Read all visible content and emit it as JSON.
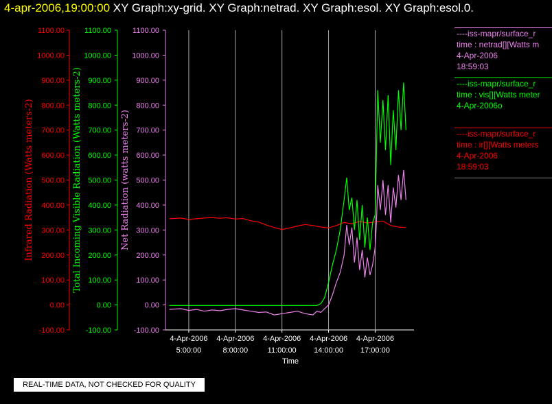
{
  "header": {
    "timestamp": "4-apr-2006,19:00:00",
    "graphs": [
      "XY Graph:xy-grid.",
      "XY Graph:netrad.",
      "XY Graph:esol.",
      "XY Graph:esol.0."
    ]
  },
  "legend": [
    {
      "line1": "----iss-mapr/surface_r",
      "line2": "time : netrad[][Watts m",
      "line3": "4-Apr-2006",
      "line4": "18:59:03",
      "color": "#ee82ee"
    },
    {
      "line1": "----iss-mapr/surface_r",
      "line2": "time : vis[][Watts meter",
      "line3": "4-Apr-2006o",
      "line4": "",
      "color": "#00ff00"
    },
    {
      "line1": "----iss-mapr/surface_r",
      "line2": "time : ir[][Watts meters",
      "line3": "4-Apr-2006",
      "line4": "18:59:03",
      "color": "#ff0000"
    }
  ],
  "notice": "REAL-TIME DATA, NOT CHECKED FOR QUALITY",
  "chart_data": {
    "type": "line",
    "xlabel": "Time",
    "x_range": [
      "4-Apr-2006 03:30:00",
      "4-Apr-2006 19:30:00"
    ],
    "x_ticks": [
      {
        "date": "4-Apr-2006",
        "time": "5:00:00",
        "x": "4-Apr-2006 05:00:00"
      },
      {
        "date": "4-Apr-2006",
        "time": "8:00:00",
        "x": "4-Apr-2006 08:00:00"
      },
      {
        "date": "4-Apr-2006",
        "time": "11:00:00",
        "x": "4-Apr-2006 11:00:00"
      },
      {
        "date": "4-Apr-2006",
        "time": "14:00:00",
        "x": "4-Apr-2006 14:00:00"
      },
      {
        "date": "4-Apr-2006",
        "time": "17:00:00",
        "x": "4-Apr-2006 17:00:00"
      }
    ],
    "y_ticks": [
      "1100.00",
      "1000.00",
      "900.00",
      "800.00",
      "700.00",
      "600.00",
      "500.00",
      "400.00",
      "300.00",
      "200.00",
      "100.00",
      "0.00",
      "-100.00"
    ],
    "ylim": [
      -100,
      1100
    ],
    "grid": "vertical lines at time ticks",
    "axes": [
      {
        "label": "Infrared Radiation (Watts meters-2)",
        "color": "#ff0000"
      },
      {
        "label": "Total Incoming Visible Radiation (Watts meters-2)",
        "color": "#00ff00"
      },
      {
        "label": "Net Radiation (watts meters-2)",
        "color": "#ee82ee"
      }
    ],
    "series": [
      {
        "color": "#ff0000",
        "points": [
          [
            "4-Apr-2006 03:45:00",
            345
          ],
          [
            "4-Apr-2006 04:30:00",
            348
          ],
          [
            "4-Apr-2006 05:00:00",
            342
          ],
          [
            "4-Apr-2006 05:30:00",
            345
          ],
          [
            "4-Apr-2006 06:00:00",
            348
          ],
          [
            "4-Apr-2006 06:30:00",
            350
          ],
          [
            "4-Apr-2006 07:00:00",
            347
          ],
          [
            "4-Apr-2006 07:30:00",
            349
          ],
          [
            "4-Apr-2006 08:00:00",
            344
          ],
          [
            "4-Apr-2006 08:30:00",
            346
          ],
          [
            "4-Apr-2006 09:00:00",
            337
          ],
          [
            "4-Apr-2006 09:30:00",
            332
          ],
          [
            "4-Apr-2006 10:00:00",
            320
          ],
          [
            "4-Apr-2006 10:30:00",
            310
          ],
          [
            "4-Apr-2006 11:00:00",
            302
          ],
          [
            "4-Apr-2006 11:30:00",
            308
          ],
          [
            "4-Apr-2006 12:00:00",
            316
          ],
          [
            "4-Apr-2006 12:30:00",
            322
          ],
          [
            "4-Apr-2006 13:00:00",
            318
          ],
          [
            "4-Apr-2006 13:30:00",
            312
          ],
          [
            "4-Apr-2006 14:00:00",
            308
          ],
          [
            "4-Apr-2006 14:30:00",
            318
          ],
          [
            "4-Apr-2006 15:00:00",
            330
          ],
          [
            "4-Apr-2006 15:30:00",
            325
          ],
          [
            "4-Apr-2006 16:00:00",
            335
          ],
          [
            "4-Apr-2006 16:30:00",
            328
          ],
          [
            "4-Apr-2006 17:00:00",
            332
          ],
          [
            "4-Apr-2006 17:30:00",
            336
          ],
          [
            "4-Apr-2006 18:00:00",
            318
          ],
          [
            "4-Apr-2006 18:30:00",
            312
          ],
          [
            "4-Apr-2006 18:59:00",
            310
          ]
        ]
      },
      {
        "color": "#00ff00",
        "points": [
          [
            "4-Apr-2006 03:45:00",
            -2
          ],
          [
            "4-Apr-2006 06:00:00",
            -2
          ],
          [
            "4-Apr-2006 08:00:00",
            -2
          ],
          [
            "4-Apr-2006 10:00:00",
            -2
          ],
          [
            "4-Apr-2006 12:00:00",
            -2
          ],
          [
            "4-Apr-2006 13:15:00",
            -2
          ],
          [
            "4-Apr-2006 13:30:00",
            5
          ],
          [
            "4-Apr-2006 13:45:00",
            30
          ],
          [
            "4-Apr-2006 14:00:00",
            90
          ],
          [
            "4-Apr-2006 14:15:00",
            160
          ],
          [
            "4-Apr-2006 14:30:00",
            220
          ],
          [
            "4-Apr-2006 14:45:00",
            300
          ],
          [
            "4-Apr-2006 15:00:00",
            420
          ],
          [
            "4-Apr-2006 15:10:00",
            510
          ],
          [
            "4-Apr-2006 15:20:00",
            380
          ],
          [
            "4-Apr-2006 15:30:00",
            430
          ],
          [
            "4-Apr-2006 15:40:00",
            300
          ],
          [
            "4-Apr-2006 15:50:00",
            420
          ],
          [
            "4-Apr-2006 16:00:00",
            260
          ],
          [
            "4-Apr-2006 16:10:00",
            400
          ],
          [
            "4-Apr-2006 16:20:00",
            230
          ],
          [
            "4-Apr-2006 16:30:00",
            350
          ],
          [
            "4-Apr-2006 16:40:00",
            220
          ],
          [
            "4-Apr-2006 16:50:00",
            330
          ],
          [
            "4-Apr-2006 17:00:00",
            360
          ],
          [
            "4-Apr-2006 17:05:00",
            600
          ],
          [
            "4-Apr-2006 17:10:00",
            860
          ],
          [
            "4-Apr-2006 17:20:00",
            650
          ],
          [
            "4-Apr-2006 17:30:00",
            820
          ],
          [
            "4-Apr-2006 17:40:00",
            620
          ],
          [
            "4-Apr-2006 17:50:00",
            840
          ],
          [
            "4-Apr-2006 18:00:00",
            560
          ],
          [
            "4-Apr-2006 18:10:00",
            780
          ],
          [
            "4-Apr-2006 18:20:00",
            620
          ],
          [
            "4-Apr-2006 18:30:00",
            860
          ],
          [
            "4-Apr-2006 18:40:00",
            700
          ],
          [
            "4-Apr-2006 18:50:00",
            890
          ],
          [
            "4-Apr-2006 18:59:00",
            700
          ]
        ]
      },
      {
        "color": "#ee82ee",
        "points": [
          [
            "4-Apr-2006 03:45:00",
            -18
          ],
          [
            "4-Apr-2006 04:30:00",
            -15
          ],
          [
            "4-Apr-2006 05:00:00",
            -22
          ],
          [
            "4-Apr-2006 05:30:00",
            -18
          ],
          [
            "4-Apr-2006 06:00:00",
            -25
          ],
          [
            "4-Apr-2006 06:30:00",
            -20
          ],
          [
            "4-Apr-2006 07:00:00",
            -23
          ],
          [
            "4-Apr-2006 07:30:00",
            -18
          ],
          [
            "4-Apr-2006 08:00:00",
            -15
          ],
          [
            "4-Apr-2006 08:30:00",
            -20
          ],
          [
            "4-Apr-2006 09:00:00",
            -25
          ],
          [
            "4-Apr-2006 09:30:00",
            -30
          ],
          [
            "4-Apr-2006 10:00:00",
            -28
          ],
          [
            "4-Apr-2006 10:30:00",
            -40
          ],
          [
            "4-Apr-2006 11:00:00",
            -35
          ],
          [
            "4-Apr-2006 11:30:00",
            -30
          ],
          [
            "4-Apr-2006 12:00:00",
            -25
          ],
          [
            "4-Apr-2006 12:30:00",
            -35
          ],
          [
            "4-Apr-2006 13:00:00",
            -40
          ],
          [
            "4-Apr-2006 13:15:00",
            -25
          ],
          [
            "4-Apr-2006 13:30:00",
            -30
          ],
          [
            "4-Apr-2006 13:45:00",
            -15
          ],
          [
            "4-Apr-2006 14:00:00",
            0
          ],
          [
            "4-Apr-2006 14:15:00",
            40
          ],
          [
            "4-Apr-2006 14:30:00",
            90
          ],
          [
            "4-Apr-2006 14:45:00",
            130
          ],
          [
            "4-Apr-2006 15:00:00",
            200
          ],
          [
            "4-Apr-2006 15:10:00",
            320
          ],
          [
            "4-Apr-2006 15:20:00",
            240
          ],
          [
            "4-Apr-2006 15:30:00",
            310
          ],
          [
            "4-Apr-2006 15:40:00",
            170
          ],
          [
            "4-Apr-2006 15:50:00",
            270
          ],
          [
            "4-Apr-2006 16:00:00",
            140
          ],
          [
            "4-Apr-2006 16:10:00",
            220
          ],
          [
            "4-Apr-2006 16:20:00",
            110
          ],
          [
            "4-Apr-2006 16:30:00",
            190
          ],
          [
            "4-Apr-2006 16:40:00",
            120
          ],
          [
            "4-Apr-2006 16:50:00",
            160
          ],
          [
            "4-Apr-2006 17:00:00",
            230
          ],
          [
            "4-Apr-2006 17:05:00",
            330
          ],
          [
            "4-Apr-2006 17:10:00",
            480
          ],
          [
            "4-Apr-2006 17:20:00",
            380
          ],
          [
            "4-Apr-2006 17:30:00",
            500
          ],
          [
            "4-Apr-2006 17:40:00",
            360
          ],
          [
            "4-Apr-2006 17:50:00",
            480
          ],
          [
            "4-Apr-2006 18:00:00",
            330
          ],
          [
            "4-Apr-2006 18:10:00",
            470
          ],
          [
            "4-Apr-2006 18:20:00",
            390
          ],
          [
            "4-Apr-2006 18:30:00",
            520
          ],
          [
            "4-Apr-2006 18:40:00",
            420
          ],
          [
            "4-Apr-2006 18:50:00",
            540
          ],
          [
            "4-Apr-2006 18:59:00",
            420
          ]
        ]
      }
    ]
  }
}
